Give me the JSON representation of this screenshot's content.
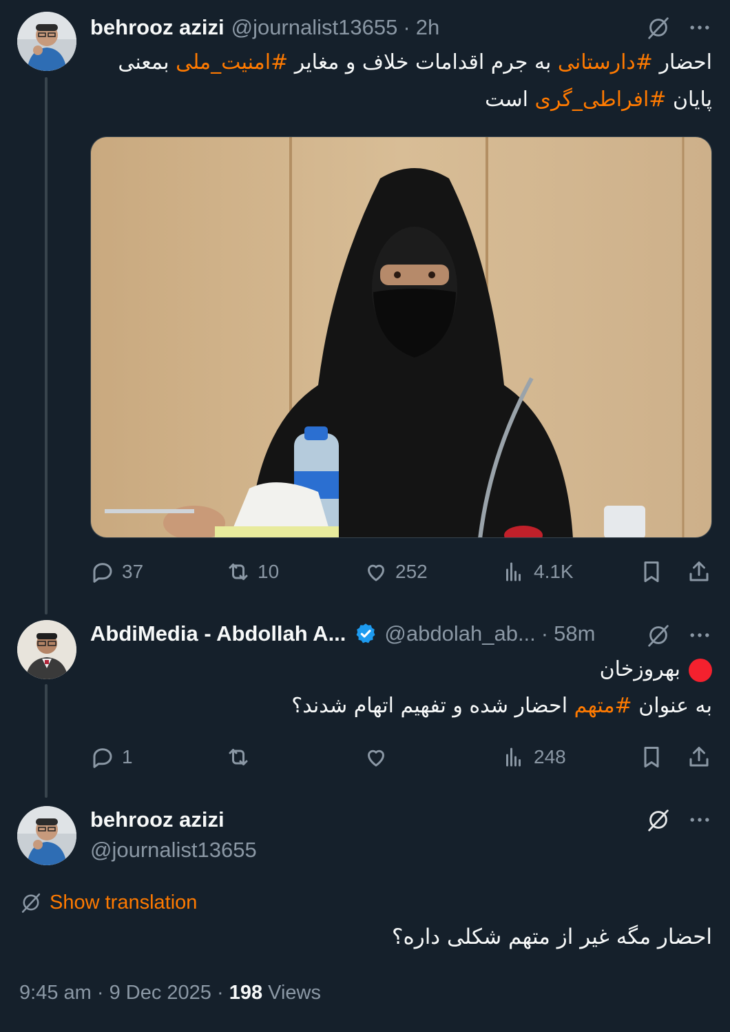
{
  "tweets": [
    {
      "name": "behrooz azizi",
      "handle": "@journalist13655",
      "dot": "·",
      "time": "2h",
      "text_parts": [
        "احضار ",
        "#دارستانی",
        " به جرم اقدامات خلاف و مغایر ",
        "#امنیت_ملی",
        " بمعنی پایان ",
        "#افراطی_گری",
        " است"
      ],
      "media": "image-of-woman-in-black-chador-at-desk",
      "actions": {
        "reply": "37",
        "retweet": "10",
        "like": "252",
        "views": "4.1K"
      }
    },
    {
      "name": "AbdiMedia - Abdollah A...",
      "handle": "@abdolah_ab...",
      "dot": "·",
      "time": "58m",
      "verified": true,
      "line1": "بهروزخان",
      "line2_parts": [
        "به عنوان ",
        "#متهم",
        " احضار شده و تفهیم اتهام شدند؟"
      ],
      "actions": {
        "reply": "1",
        "retweet": "",
        "like": "",
        "views": "248"
      }
    },
    {
      "name": "behrooz azizi",
      "handle": "@journalist13655",
      "show_translation": "Show translation",
      "text": "احضار مگه غیر از متهم شکلی داره؟",
      "footer": {
        "time": "9:45 am",
        "dot1": "·",
        "date": "9 Dec 2025",
        "dot2": "·",
        "views_count": "198",
        "views_label": "Views"
      }
    }
  ],
  "colors": {
    "background": "#15202b",
    "hashtag": "#ff7a00",
    "muted": "#8b98a5",
    "verified": "#1d9bf0",
    "red_dot": "#f4212e"
  }
}
